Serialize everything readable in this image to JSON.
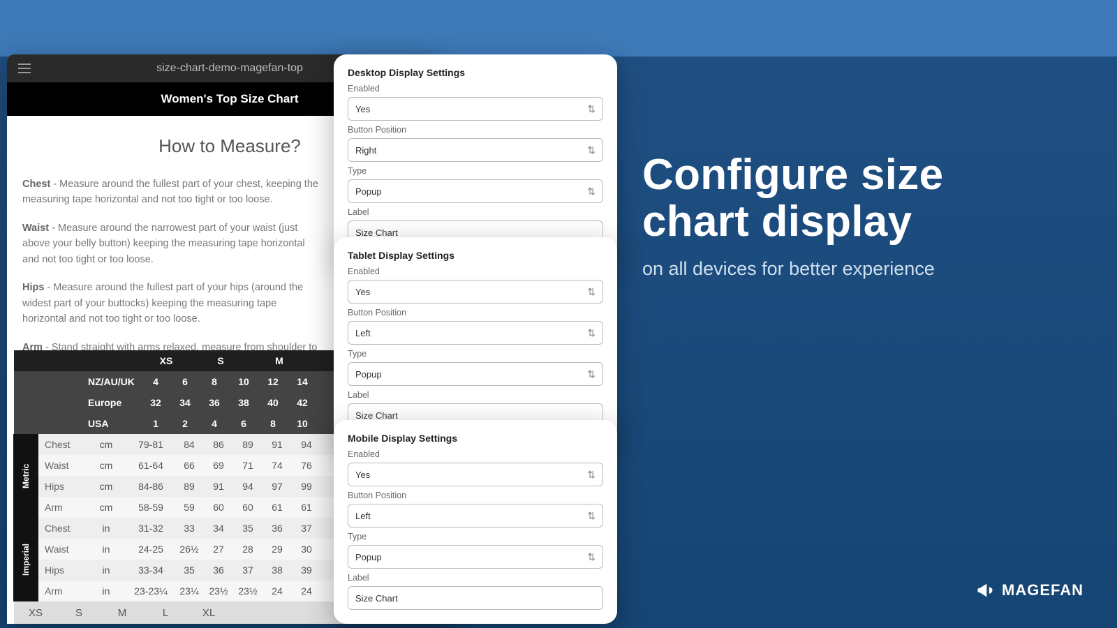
{
  "browser": {
    "tab": "size-chart-demo-magefan-top",
    "title": "Women's Top Size Chart"
  },
  "how": {
    "heading": "How to Measure?",
    "items": [
      {
        "label": "Chest",
        "text": " - Measure around the fullest part of your chest, keeping the measuring tape horizontal and not too tight or too loose."
      },
      {
        "label": "Waist",
        "text": " - Measure around the narrowest part of your waist (just above your belly button) keeping the measuring tape horizontal and not too tight or too loose."
      },
      {
        "label": "Hips",
        "text": " - Measure around the fullest part of your hips (around the widest part of your buttocks) keeping the measuring tape horizontal and not too tight or too loose."
      },
      {
        "label": "Arm",
        "text": " - Stand straight with arms relaxed, measure from shoulder to wrist bone along arm's natural curve. Bend elbow slightly for flexibility check."
      }
    ]
  },
  "table": {
    "size_groups": [
      "XS",
      "S",
      "",
      "M",
      ""
    ],
    "region_rows": [
      {
        "name": "NZ/AU/UK",
        "v": [
          "4",
          "6",
          "8",
          "10",
          "12",
          "14"
        ]
      },
      {
        "name": "Europe",
        "v": [
          "32",
          "34",
          "36",
          "38",
          "40",
          "42"
        ]
      },
      {
        "name": "USA",
        "v": [
          "1",
          "2",
          "4",
          "6",
          "8",
          "10"
        ]
      }
    ],
    "metric_label": "Metric",
    "imperial_label": "Imperial",
    "metric_rows": [
      {
        "name": "Chest",
        "unit": "cm",
        "v": [
          "79-81",
          "84",
          "86",
          "89",
          "91",
          "94"
        ]
      },
      {
        "name": "Waist",
        "unit": "cm",
        "v": [
          "61-64",
          "66",
          "69",
          "71",
          "74",
          "76"
        ]
      },
      {
        "name": "Hips",
        "unit": "cm",
        "v": [
          "84-86",
          "89",
          "91",
          "94",
          "97",
          "99"
        ]
      },
      {
        "name": "Arm",
        "unit": "cm",
        "v": [
          "58-59",
          "59",
          "60",
          "60",
          "61",
          "61"
        ]
      }
    ],
    "imperial_rows": [
      {
        "name": "Chest",
        "unit": "in",
        "v": [
          "31-32",
          "33",
          "34",
          "35",
          "36",
          "37"
        ]
      },
      {
        "name": "Waist",
        "unit": "in",
        "v": [
          "24-25",
          "26½",
          "27",
          "28",
          "29",
          "30"
        ]
      },
      {
        "name": "Hips",
        "unit": "in",
        "v": [
          "33-34",
          "35",
          "36",
          "37",
          "38",
          "39"
        ]
      },
      {
        "name": "Arm",
        "unit": "in",
        "v": [
          "23-23¼",
          "23¼",
          "23½",
          "23½",
          "24",
          "24"
        ]
      }
    ],
    "footer": [
      "XS",
      "S",
      "M",
      "L",
      "XL"
    ]
  },
  "panels": [
    {
      "title": "Desktop Display Settings",
      "enabled_label": "Enabled",
      "enabled": "Yes",
      "pos_label": "Button Position",
      "pos": "Right",
      "type_label": "Type",
      "type": "Popup",
      "label_label": "Label",
      "label": "Size Chart"
    },
    {
      "title": "Tablet Display Settings",
      "enabled_label": "Enabled",
      "enabled": "Yes",
      "pos_label": "Button Position",
      "pos": "Left",
      "type_label": "Type",
      "type": "Popup",
      "label_label": "Label",
      "label": "Size Chart"
    },
    {
      "title": "Mobile Display Settings",
      "enabled_label": "Enabled",
      "enabled": "Yes",
      "pos_label": "Button Position",
      "pos": "Left",
      "type_label": "Type",
      "type": "Popup",
      "label_label": "Label",
      "label": "Size Chart"
    }
  ],
  "headline": {
    "l1": "Configure size",
    "l2": "chart display",
    "sub": "on all devices for better experience"
  },
  "brand": "MAGEFAN"
}
